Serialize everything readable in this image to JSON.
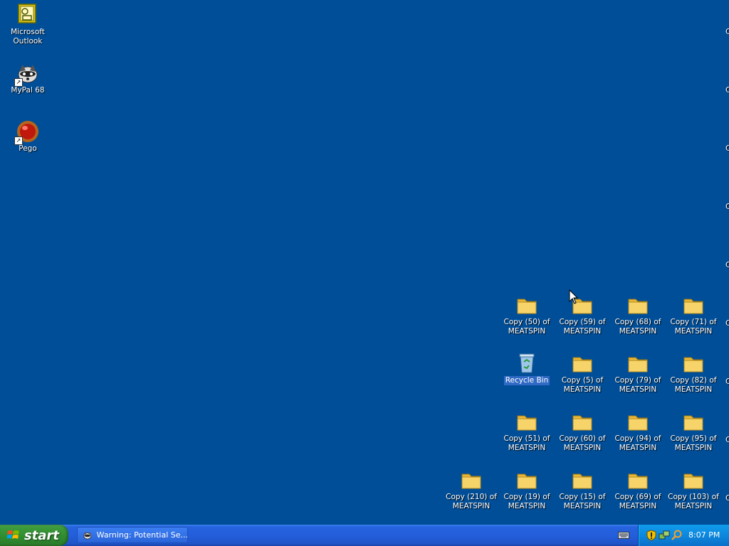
{
  "desktop": {
    "left_icons": [
      {
        "label": "Microsoft Outlook",
        "icon": "outlook-icon"
      },
      {
        "label": "MyPal 68",
        "icon": "raccoon-browser-icon"
      },
      {
        "label": "Pego",
        "icon": "red-orb-icon"
      }
    ],
    "grid": {
      "row1": [
        "Copy (50) of MEATSPIN",
        "Copy (59) of MEATSPIN",
        "Copy (68) of MEATSPIN",
        "Copy (71) of MEATSPIN"
      ],
      "row2": [
        "Recycle Bin",
        "Copy (5) of MEATSPIN",
        "Copy (79) of MEATSPIN",
        "Copy (82) of MEATSPIN"
      ],
      "row3": [
        "Copy (51) of MEATSPIN",
        "Copy (60) of MEATSPIN",
        "Copy (94) of MEATSPIN",
        "Copy (95) of MEATSPIN"
      ],
      "row4": [
        "Copy (210) of MEATSPIN",
        "Copy (19) of MEATSPIN",
        "Copy (15) of MEATSPIN",
        "Copy (69) of MEATSPIN",
        "Copy (103) of MEATSPIN"
      ]
    },
    "edge_fragment": "C"
  },
  "taskbar": {
    "start_label": "start",
    "task_item_label": "Warning: Potential Se...",
    "clock": "8:07 PM"
  },
  "colors": {
    "desktop": "#004e98",
    "taskbar": "#245edb",
    "start": "#3c9a3b",
    "tray": "#0d88dd",
    "folder": "#f6d46a"
  }
}
